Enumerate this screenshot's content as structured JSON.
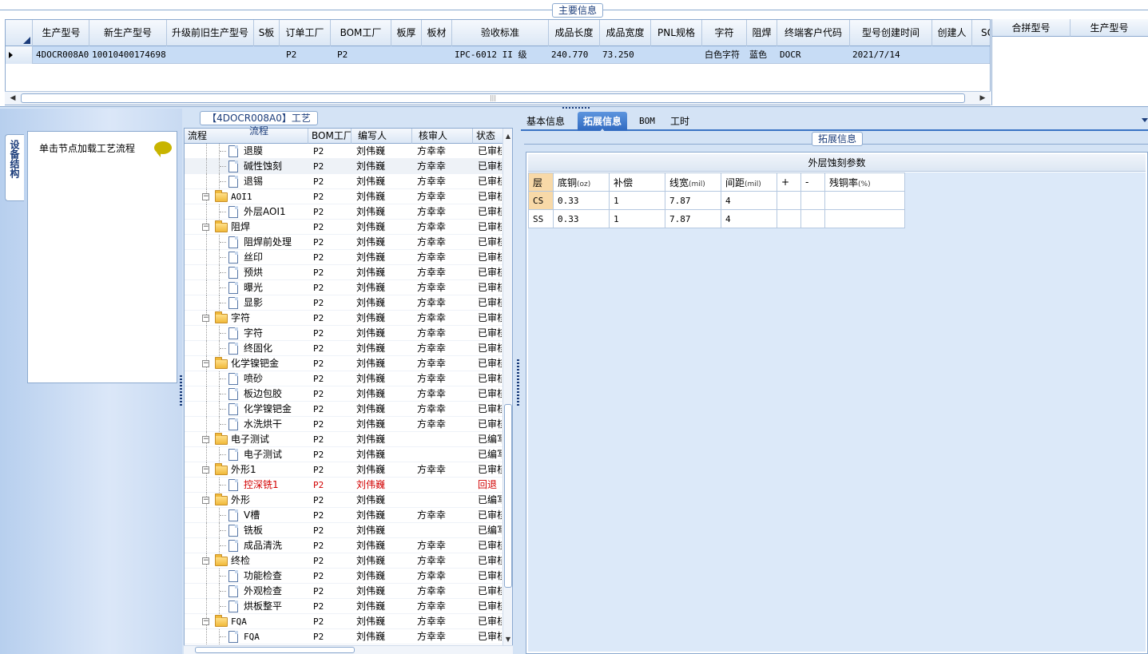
{
  "top": {
    "section_title": "主要信息",
    "columns": [
      "生产型号",
      "新生产型号",
      "升级前旧生产型号",
      "S板",
      "订单工厂",
      "BOM工厂",
      "板厚",
      "板材",
      "验收标准",
      "成品长度",
      "成品宽度",
      "PNL规格",
      "字符",
      "阻焊",
      "终端客户代码",
      "型号创建时间",
      "创建人",
      "SO"
    ],
    "row": [
      "4DOCR008A0",
      "10010400174698",
      "",
      "",
      "P2",
      "P2",
      "",
      "",
      "IPC-6012 II 级",
      "240.770",
      "73.250",
      "",
      "白色字符",
      "蓝色",
      "DOCR",
      "2021/7/14",
      "",
      ""
    ],
    "scroll_thumb_glyph": "|||"
  },
  "merge": {
    "columns": [
      "合拼型号",
      "生产型号"
    ]
  },
  "left": {
    "vertical_tab": "设备结构",
    "node_hint": "单击节点加载工艺流程"
  },
  "process": {
    "title": "【4DOCR008A0】工艺流程",
    "columns": [
      "流程",
      "BOM工厂",
      "编写人",
      "核审人",
      "状态"
    ],
    "rows": [
      {
        "level": 2,
        "type": "doc",
        "name": "退膜",
        "bom": "P2",
        "writer": "刘伟巍",
        "reviewer": "方幸幸",
        "status": "已审核"
      },
      {
        "level": 2,
        "type": "doc",
        "name": "碱性蚀刻",
        "bom": "P2",
        "writer": "刘伟巍",
        "reviewer": "方幸幸",
        "status": "已审核",
        "highlight": true
      },
      {
        "level": 2,
        "type": "doc",
        "name": "退锡",
        "bom": "P2",
        "writer": "刘伟巍",
        "reviewer": "方幸幸",
        "status": "已审核"
      },
      {
        "level": 1,
        "type": "folder",
        "name": "AOI1",
        "bom": "P2",
        "writer": "刘伟巍",
        "reviewer": "方幸幸",
        "status": "已审核"
      },
      {
        "level": 2,
        "type": "doc",
        "name": "外层AOI1",
        "bom": "P2",
        "writer": "刘伟巍",
        "reviewer": "方幸幸",
        "status": "已审核"
      },
      {
        "level": 1,
        "type": "folder",
        "name": "阻焊",
        "bom": "P2",
        "writer": "刘伟巍",
        "reviewer": "方幸幸",
        "status": "已审核"
      },
      {
        "level": 2,
        "type": "doc",
        "name": "阻焊前处理",
        "bom": "P2",
        "writer": "刘伟巍",
        "reviewer": "方幸幸",
        "status": "已审核"
      },
      {
        "level": 2,
        "type": "doc",
        "name": "丝印",
        "bom": "P2",
        "writer": "刘伟巍",
        "reviewer": "方幸幸",
        "status": "已审核"
      },
      {
        "level": 2,
        "type": "doc",
        "name": "预烘",
        "bom": "P2",
        "writer": "刘伟巍",
        "reviewer": "方幸幸",
        "status": "已审核"
      },
      {
        "level": 2,
        "type": "doc",
        "name": "曝光",
        "bom": "P2",
        "writer": "刘伟巍",
        "reviewer": "方幸幸",
        "status": "已审核"
      },
      {
        "level": 2,
        "type": "doc",
        "name": "显影",
        "bom": "P2",
        "writer": "刘伟巍",
        "reviewer": "方幸幸",
        "status": "已审核"
      },
      {
        "level": 1,
        "type": "folder",
        "name": "字符",
        "bom": "P2",
        "writer": "刘伟巍",
        "reviewer": "方幸幸",
        "status": "已审核"
      },
      {
        "level": 2,
        "type": "doc",
        "name": "字符",
        "bom": "P2",
        "writer": "刘伟巍",
        "reviewer": "方幸幸",
        "status": "已审核"
      },
      {
        "level": 2,
        "type": "doc",
        "name": "终固化",
        "bom": "P2",
        "writer": "刘伟巍",
        "reviewer": "方幸幸",
        "status": "已审核"
      },
      {
        "level": 1,
        "type": "folder",
        "name": "化学镍钯金",
        "bom": "P2",
        "writer": "刘伟巍",
        "reviewer": "方幸幸",
        "status": "已审核"
      },
      {
        "level": 2,
        "type": "doc",
        "name": "喷砂",
        "bom": "P2",
        "writer": "刘伟巍",
        "reviewer": "方幸幸",
        "status": "已审核"
      },
      {
        "level": 2,
        "type": "doc",
        "name": "板边包胶",
        "bom": "P2",
        "writer": "刘伟巍",
        "reviewer": "方幸幸",
        "status": "已审核"
      },
      {
        "level": 2,
        "type": "doc",
        "name": "化学镍钯金",
        "bom": "P2",
        "writer": "刘伟巍",
        "reviewer": "方幸幸",
        "status": "已审核"
      },
      {
        "level": 2,
        "type": "doc",
        "name": "水洗烘干",
        "bom": "P2",
        "writer": "刘伟巍",
        "reviewer": "方幸幸",
        "status": "已审核"
      },
      {
        "level": 1,
        "type": "folder",
        "name": "电子测试",
        "bom": "P2",
        "writer": "刘伟巍",
        "reviewer": "",
        "status": "已编写"
      },
      {
        "level": 2,
        "type": "doc",
        "name": "电子测试",
        "bom": "P2",
        "writer": "刘伟巍",
        "reviewer": "",
        "status": "已编写"
      },
      {
        "level": 1,
        "type": "folder",
        "name": "外形1",
        "bom": "P2",
        "writer": "刘伟巍",
        "reviewer": "方幸幸",
        "status": "已审核"
      },
      {
        "level": 2,
        "type": "doc",
        "name": "控深铣1",
        "bom": "P2",
        "writer": "刘伟巍",
        "reviewer": "",
        "status": "回退",
        "red": true
      },
      {
        "level": 1,
        "type": "folder",
        "name": "外形",
        "bom": "P2",
        "writer": "刘伟巍",
        "reviewer": "",
        "status": "已编写"
      },
      {
        "level": 2,
        "type": "doc",
        "name": "V槽",
        "bom": "P2",
        "writer": "刘伟巍",
        "reviewer": "方幸幸",
        "status": "已审核"
      },
      {
        "level": 2,
        "type": "doc",
        "name": "铣板",
        "bom": "P2",
        "writer": "刘伟巍",
        "reviewer": "",
        "status": "已编写"
      },
      {
        "level": 2,
        "type": "doc",
        "name": "成品清洗",
        "bom": "P2",
        "writer": "刘伟巍",
        "reviewer": "方幸幸",
        "status": "已审核"
      },
      {
        "level": 1,
        "type": "folder",
        "name": "终检",
        "bom": "P2",
        "writer": "刘伟巍",
        "reviewer": "方幸幸",
        "status": "已审核"
      },
      {
        "level": 2,
        "type": "doc",
        "name": "功能检查",
        "bom": "P2",
        "writer": "刘伟巍",
        "reviewer": "方幸幸",
        "status": "已审核"
      },
      {
        "level": 2,
        "type": "doc",
        "name": "外观检查",
        "bom": "P2",
        "writer": "刘伟巍",
        "reviewer": "方幸幸",
        "status": "已审核"
      },
      {
        "level": 2,
        "type": "doc",
        "name": "烘板整平",
        "bom": "P2",
        "writer": "刘伟巍",
        "reviewer": "方幸幸",
        "status": "已审核"
      },
      {
        "level": 1,
        "type": "folder",
        "name": "FQA",
        "bom": "P2",
        "writer": "刘伟巍",
        "reviewer": "方幸幸",
        "status": "已审核"
      },
      {
        "level": 2,
        "type": "doc",
        "name": "FQA",
        "bom": "P2",
        "writer": "刘伟巍",
        "reviewer": "方幸幸",
        "status": "已审核"
      }
    ]
  },
  "right": {
    "tabs": [
      "基本信息",
      "拓展信息",
      "BOM",
      "工时"
    ],
    "active_tab": "拓展信息",
    "section_title": "拓展信息",
    "table_title": "外层蚀刻参数",
    "table_headers": [
      {
        "text": "层",
        "unit": ""
      },
      {
        "text": "底铜",
        "unit": "(oz)"
      },
      {
        "text": "补偿",
        "unit": ""
      },
      {
        "text": "线宽",
        "unit": "(mil)"
      },
      {
        "text": "间距",
        "unit": "(mil)"
      },
      {
        "text": "+",
        "unit": ""
      },
      {
        "text": "-",
        "unit": ""
      },
      {
        "text": "残铜率",
        "unit": "(%)"
      }
    ],
    "table_rows": [
      [
        "CS",
        "0.33",
        "1",
        "7.87",
        "4",
        "",
        "",
        ""
      ],
      [
        "SS",
        "0.33",
        "1",
        "7.87",
        "4",
        "",
        "",
        ""
      ]
    ]
  },
  "colors": {
    "accent": "#2f69c0",
    "selected_row": "#c7dcf5",
    "header_highlight": "#f8d9a8",
    "error_text": "#d20000"
  }
}
